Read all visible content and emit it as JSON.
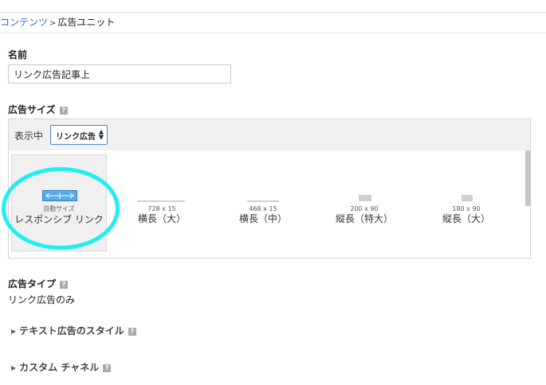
{
  "breadcrumb": {
    "parent": "コンテンツ",
    "separator": ">",
    "current": "広告ユニット"
  },
  "name_section": {
    "label": "名前",
    "value": "リンク広告記事上"
  },
  "size_section": {
    "label": "広告サイズ",
    "help_glyph": "?",
    "show_label": "表示中",
    "filter_value": "リンク広告",
    "tiles": [
      {
        "dim": "自動サイズ",
        "name": "レスポンシブ リンク"
      },
      {
        "dim": "728 x 15",
        "name": "横長（大）"
      },
      {
        "dim": "468 x 15",
        "name": "横長（中）"
      },
      {
        "dim": "200 x 90",
        "name": "縦長（特大）"
      },
      {
        "dim": "180 x 90",
        "name": "縦長（大）"
      }
    ]
  },
  "type_section": {
    "label": "広告タイプ",
    "help_glyph": "?",
    "value": "リンク広告のみ"
  },
  "text_style_section": {
    "label": "テキスト広告のスタイル",
    "help_glyph": "?"
  },
  "custom_channel_section": {
    "label": "カスタム チャネル",
    "help_glyph": "?"
  },
  "colors": {
    "accent": "#3366cc",
    "highlight": "#1ef0f0",
    "icon_fill": "#5aaae8"
  }
}
